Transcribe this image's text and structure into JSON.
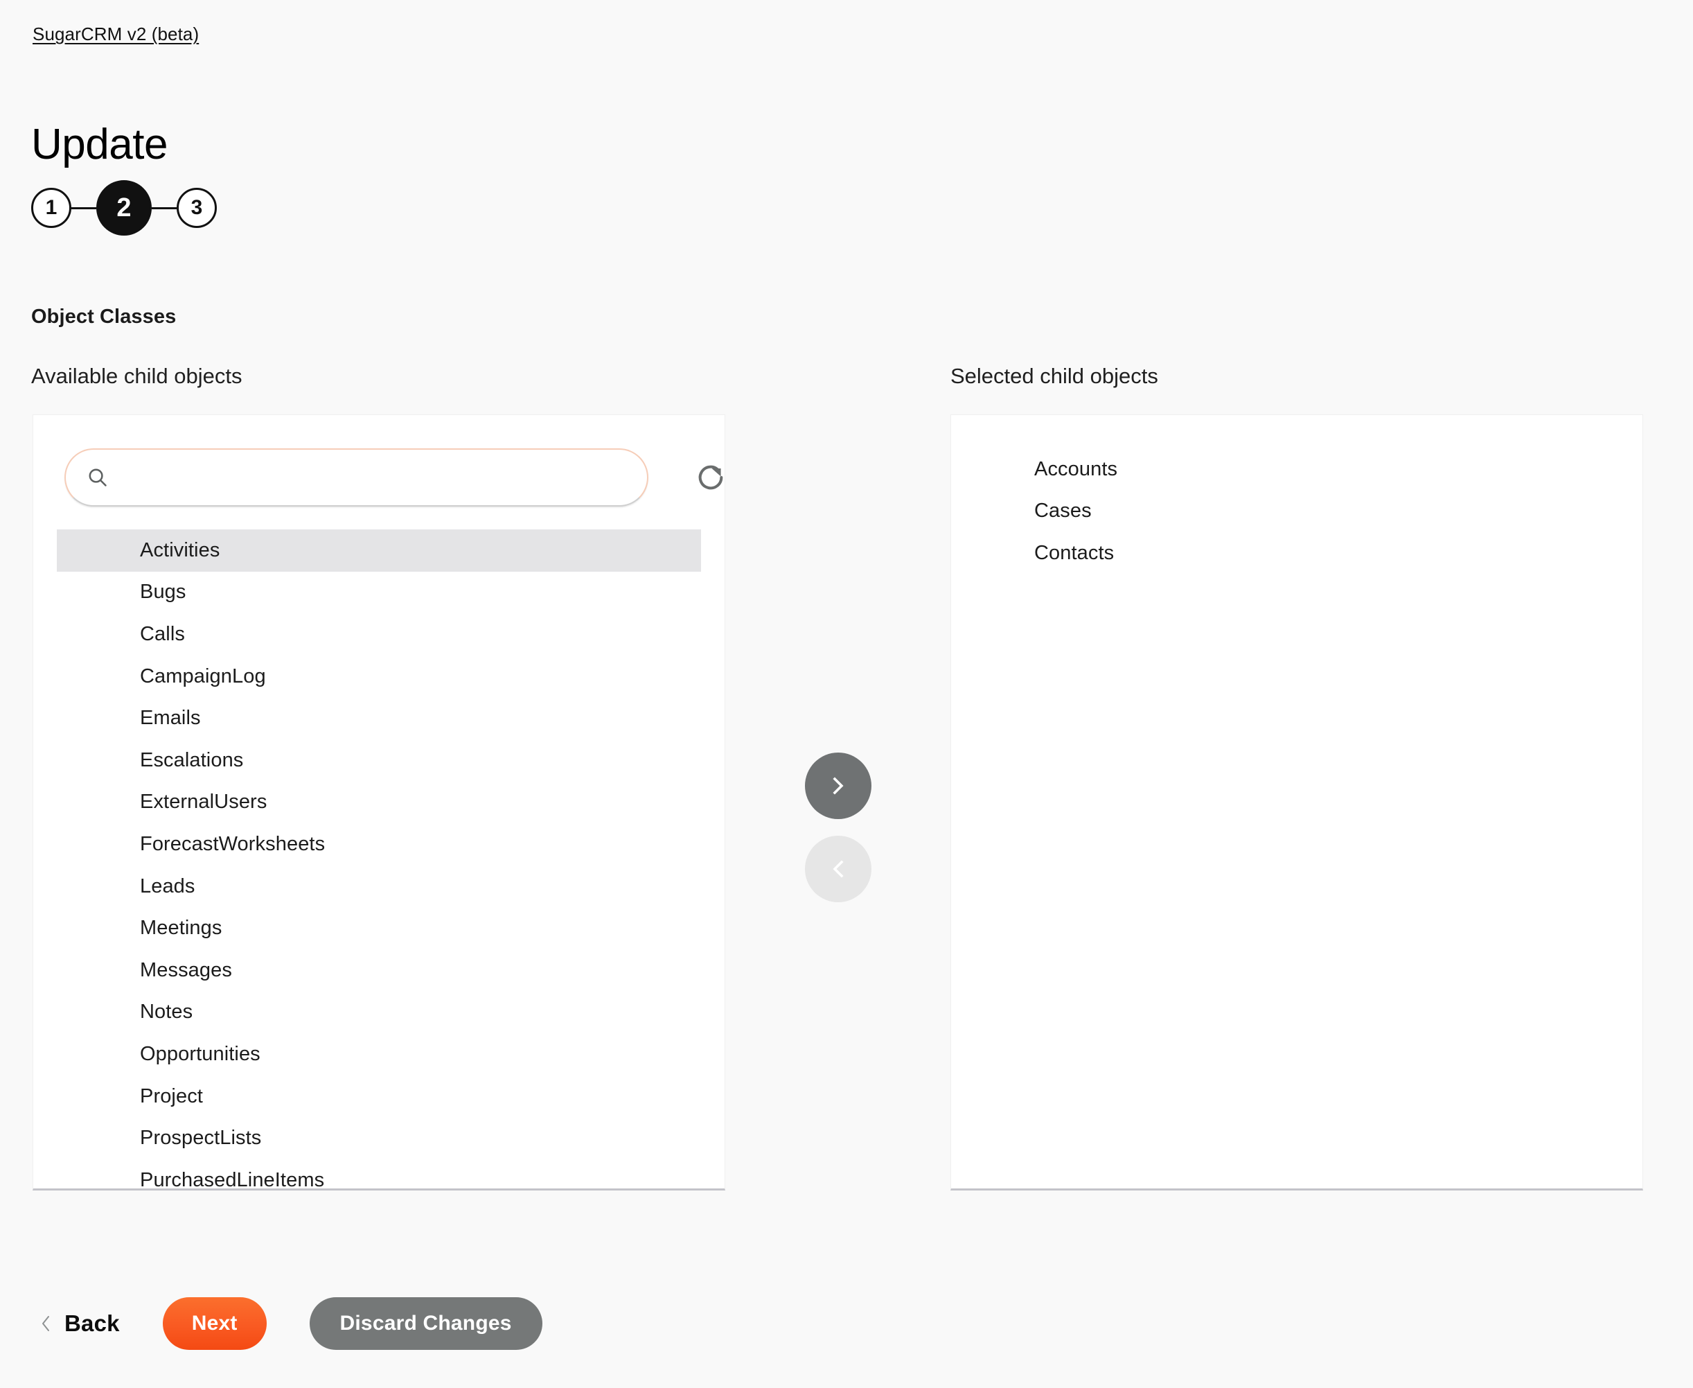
{
  "app": {
    "breadcrumb_label": "SugarCRM v2 (beta)",
    "page_title": "Update"
  },
  "stepper": {
    "steps": [
      {
        "number": "1",
        "state": "inactive"
      },
      {
        "number": "2",
        "state": "active"
      },
      {
        "number": "3",
        "state": "inactive"
      }
    ]
  },
  "section": {
    "title": "Object Classes",
    "available_label": "Available child objects",
    "selected_label": "Selected child objects"
  },
  "search": {
    "value": "",
    "placeholder": "",
    "icon": "search-icon",
    "refresh_icon": "refresh-icon"
  },
  "available_objects": [
    {
      "label": "Activities",
      "selected": true
    },
    {
      "label": "Bugs",
      "selected": false
    },
    {
      "label": "Calls",
      "selected": false
    },
    {
      "label": "CampaignLog",
      "selected": false
    },
    {
      "label": "Emails",
      "selected": false
    },
    {
      "label": "Escalations",
      "selected": false
    },
    {
      "label": "ExternalUsers",
      "selected": false
    },
    {
      "label": "ForecastWorksheets",
      "selected": false
    },
    {
      "label": "Leads",
      "selected": false
    },
    {
      "label": "Meetings",
      "selected": false
    },
    {
      "label": "Messages",
      "selected": false
    },
    {
      "label": "Notes",
      "selected": false
    },
    {
      "label": "Opportunities",
      "selected": false
    },
    {
      "label": "Project",
      "selected": false
    },
    {
      "label": "ProspectLists",
      "selected": false
    },
    {
      "label": "PurchasedLineItems",
      "selected": false
    }
  ],
  "selected_objects": [
    {
      "label": "Accounts"
    },
    {
      "label": "Cases"
    },
    {
      "label": "Contacts"
    }
  ],
  "transfer": {
    "add_icon": "chevron-right-icon",
    "remove_icon": "chevron-left-icon",
    "add_enabled": true,
    "remove_enabled": false
  },
  "footer": {
    "back_label": "Back",
    "back_icon": "chevron-left-icon",
    "next_label": "Next",
    "discard_label": "Discard Changes"
  },
  "colors": {
    "page_background": "#f9f9f9",
    "panel_background": "#ffffff",
    "accent_orange": "#f95a22",
    "next_gradient_top": "#fb6f2d",
    "next_gradient_bottom": "#f44a13",
    "discard_gray": "#757878",
    "transfer_enabled_gray": "#6f7273",
    "transfer_disabled_gray": "#e6e6e6",
    "row_selected_gray": "#e4e4e6",
    "search_border_peach": "#f6cdb8",
    "step_black": "#111111",
    "panel_bottom_border": "#c3c3c9"
  }
}
